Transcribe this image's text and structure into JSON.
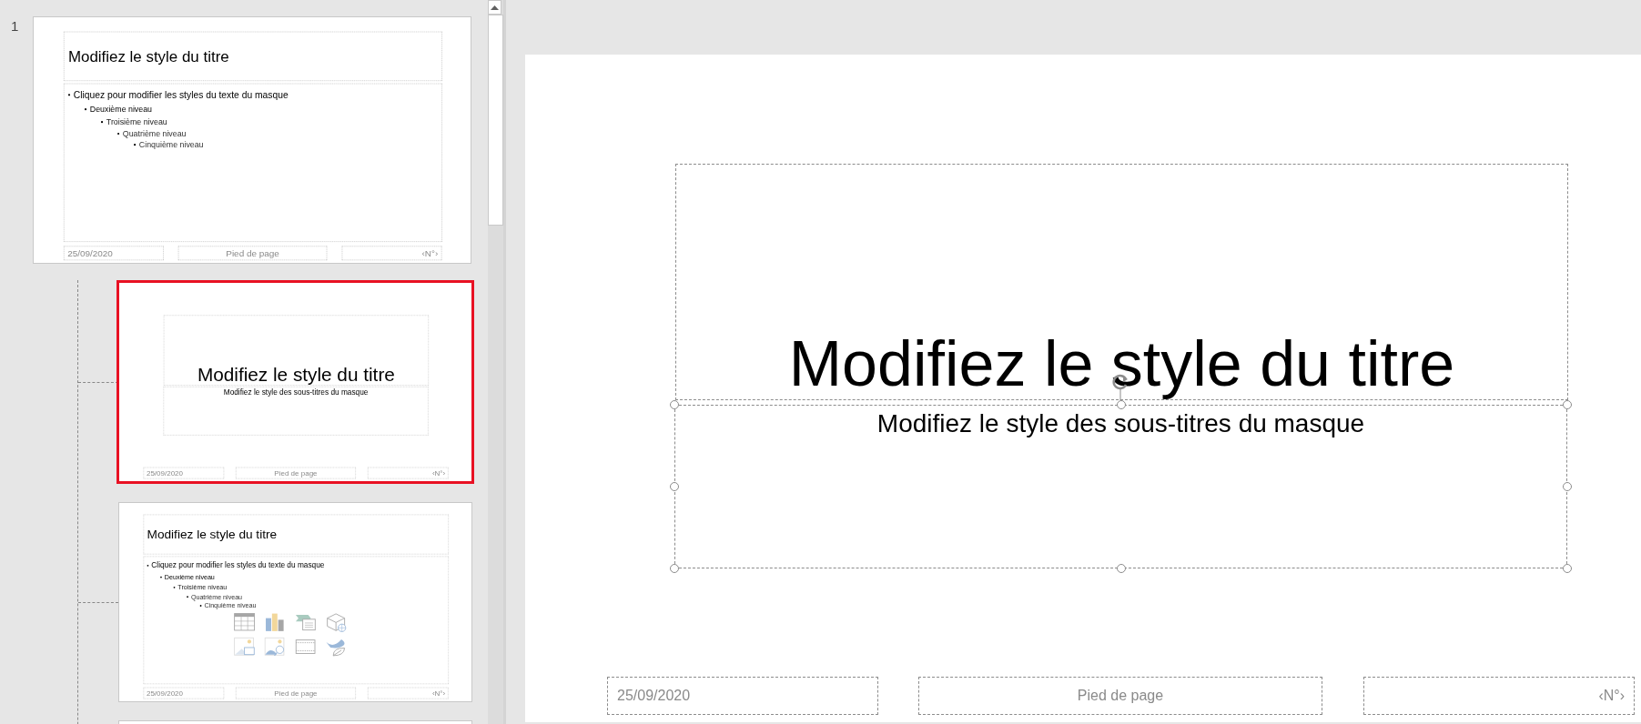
{
  "thumbnails": [
    {
      "number": "1",
      "selected": false,
      "kind": "master",
      "title": "Modifiez le style du titre",
      "body": [
        {
          "text": "Cliquez pour modifier les styles du texte du masque",
          "children": [
            {
              "text": "Deuxième niveau",
              "children": [
                {
                  "text": "Troisième niveau",
                  "children": [
                    {
                      "text": "Quatrième niveau",
                      "children": [
                        {
                          "text": "Cinquième niveau"
                        }
                      ]
                    }
                  ]
                }
              ]
            }
          ]
        }
      ],
      "footer": {
        "date": "25/09/2020",
        "text": "Pied de page",
        "number": "‹N°›"
      },
      "children": [
        {
          "selected": true,
          "kind": "title",
          "title": "Modifiez le style du titre",
          "subtitle": {
            "text": "Modifiez le style des sous-titres du masque",
            "selected": false
          },
          "footer": {
            "date": "25/09/2020",
            "text": "Pied de page",
            "number": "‹N°›"
          }
        },
        {
          "selected": false,
          "kind": "content",
          "title": "Modifiez le style du titre",
          "body": [
            {
              "text": "Cliquez pour modifier les styles du texte du masque",
              "children": [
                {
                  "text": "Deuxième niveau",
                  "children": [
                    {
                      "text": "Troisième niveau",
                      "children": [
                        {
                          "text": "Quatrième niveau",
                          "children": [
                            {
                              "text": "Cinquième niveau"
                            }
                          ]
                        }
                      ]
                    }
                  ]
                }
              ]
            }
          ],
          "footer": {
            "date": "25/09/2020",
            "text": "Pied de page",
            "number": "‹N°›"
          }
        },
        {
          "selected": false
        }
      ]
    }
  ],
  "slide": {
    "kind": "title",
    "title": "Modifiez le style du titre",
    "subtitle": {
      "text": "Modifiez le style des sous-titres du masque",
      "selected": true
    },
    "footer": {
      "date": "25/09/2020",
      "text": "Pied de page",
      "number": "‹N°›"
    }
  }
}
